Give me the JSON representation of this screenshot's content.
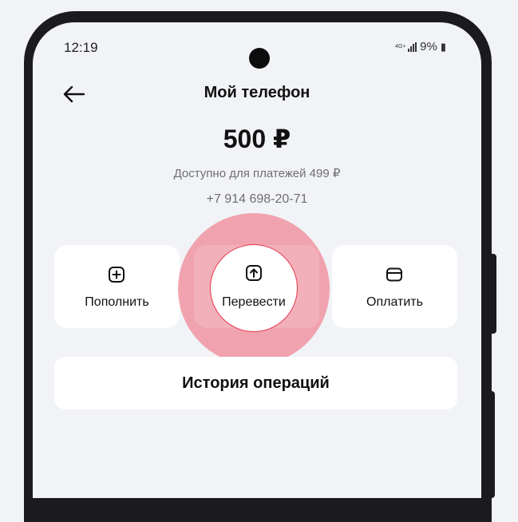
{
  "status_bar": {
    "time": "12:19",
    "network": "4G+",
    "battery": "9%"
  },
  "header": {
    "back_icon": "arrow-left-icon",
    "title": "Мой телефон"
  },
  "balance": {
    "amount": "500 ₽",
    "available": "Доступно для платежей 499 ₽",
    "phone": "+7 914 698-20-71"
  },
  "actions": [
    {
      "label": "Пополнить",
      "icon": "plus-square-icon"
    },
    {
      "label": "Перевести",
      "icon": "arrow-up-square-icon"
    },
    {
      "label": "Оплатить",
      "icon": "wallet-icon"
    }
  ],
  "history": {
    "label": "История операций"
  },
  "colors": {
    "background": "#f1f3f7",
    "card": "#ffffff",
    "highlight": "#ee6072",
    "highlight_border": "#e8374c"
  }
}
